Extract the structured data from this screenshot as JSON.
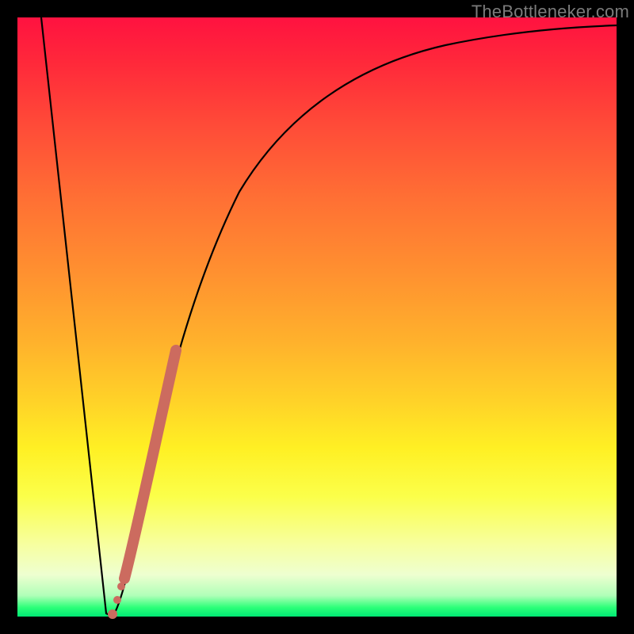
{
  "watermark": "TheBottleneker.com",
  "chart_data": {
    "type": "line",
    "title": "",
    "xlabel": "",
    "ylabel": "",
    "xlim": [
      0,
      100
    ],
    "ylim": [
      0,
      100
    ],
    "series": [
      {
        "name": "bottleneck-curve",
        "x": [
          4,
          14,
          15,
          17,
          20,
          24,
          28,
          34,
          42,
          52,
          64,
          78,
          92,
          100
        ],
        "y": [
          100,
          2,
          0,
          4,
          18,
          38,
          54,
          68,
          79,
          87,
          92,
          95,
          96.5,
          97
        ]
      }
    ],
    "highlight_segment": {
      "name": "thick-salmon-band",
      "color": "#cc6b5f",
      "x": [
        17.5,
        26.5
      ],
      "y": [
        6,
        47
      ]
    },
    "highlight_dots": {
      "color": "#cc6b5f",
      "points": [
        {
          "x": 15.0,
          "y": 0.5
        },
        {
          "x": 15.8,
          "y": 4.0
        },
        {
          "x": 16.8,
          "y": 8.0
        }
      ]
    }
  }
}
